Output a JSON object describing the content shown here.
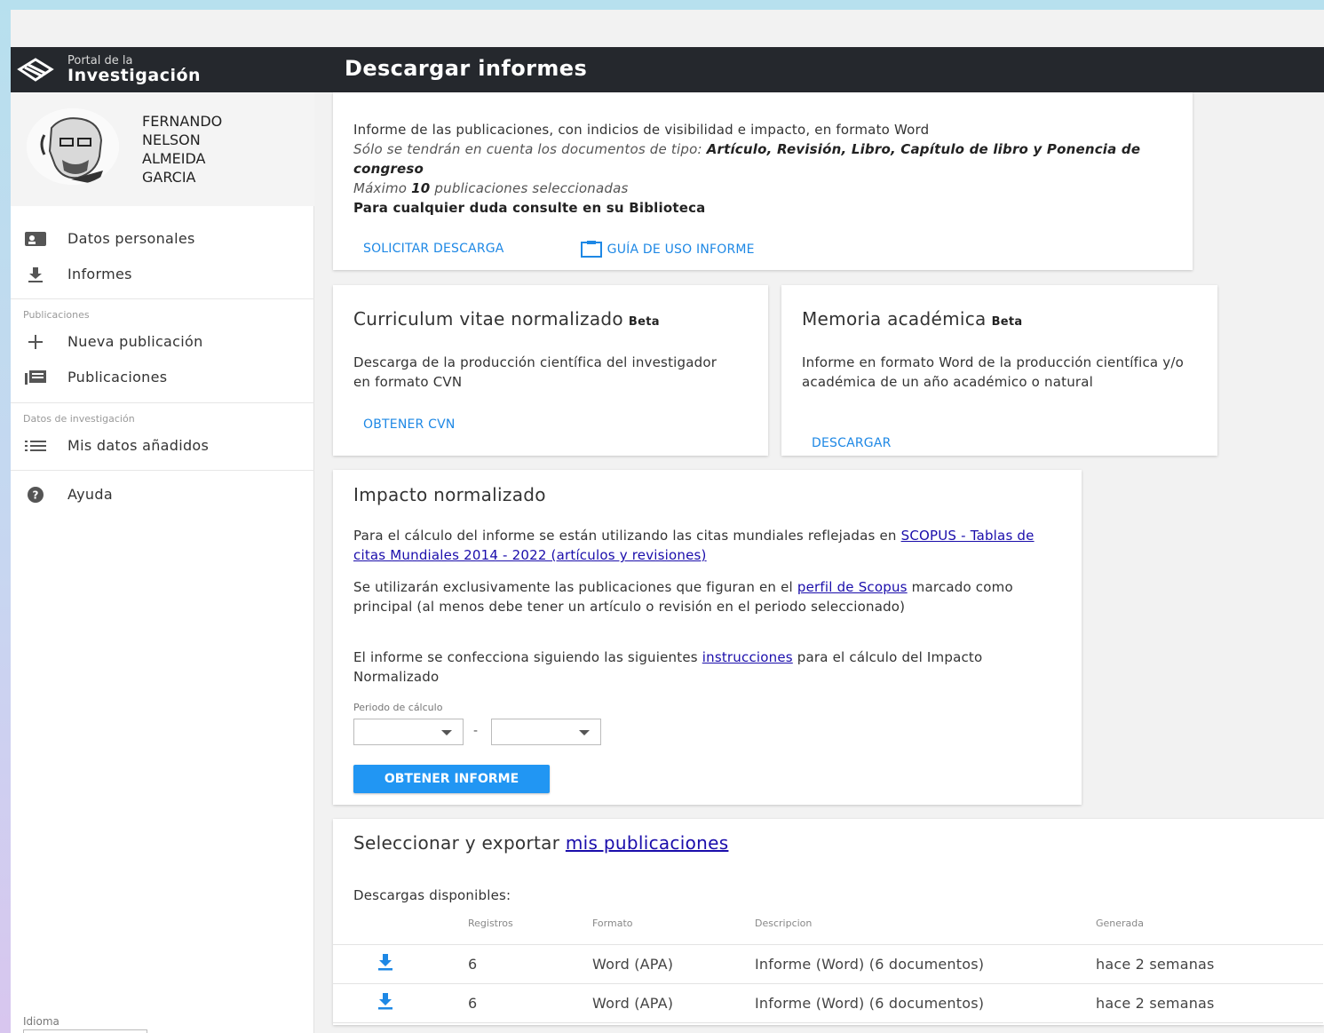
{
  "header": {
    "brand_small": "Portal de la",
    "brand_large": "Investigación",
    "page_title": "Descargar informes"
  },
  "sidebar": {
    "user_name": [
      "FERNANDO",
      "NELSON",
      "ALMEIDA",
      "GARCIA"
    ],
    "items_main": [
      {
        "label": "Datos personales",
        "icon": "id-card-icon"
      },
      {
        "label": "Informes",
        "icon": "download-icon"
      }
    ],
    "section_publicaciones": "Publicaciones",
    "items_publicaciones": [
      {
        "label": "Nueva publicación",
        "icon": "plus-icon"
      },
      {
        "label": "Publicaciones",
        "icon": "library-icon"
      }
    ],
    "section_datos": "Datos de investigación",
    "items_datos": [
      {
        "label": "Mis datos añadidos",
        "icon": "list-icon"
      }
    ],
    "help": {
      "label": "Ayuda",
      "icon": "help-icon"
    },
    "language_label": "Idioma"
  },
  "card_publicaciones": {
    "line1": "Informe de las publicaciones, con indicios de visibilidad e impacto, en formato Word",
    "line2_italic": "Sólo se tendrán en cuenta los documentos de tipo: ",
    "line2_bold": "Artículo, Revisión, Libro, Capítulo de libro y Ponencia de congreso",
    "line3_pre": "Máximo ",
    "line3_num": "10",
    "line3_post": " publicaciones seleccionadas",
    "line4": "Para cualquier duda consulte en su Biblioteca",
    "btn_request": "SOLICITAR DESCARGA",
    "btn_guide": "GUÍA DE USO INFORME"
  },
  "card_cvn": {
    "title": "Curriculum vitae normalizado",
    "beta": "Beta",
    "desc": "Descarga de la producción científica del investigador en formato CVN",
    "btn": "OBTENER CVN"
  },
  "card_memoria": {
    "title": "Memoria académica",
    "beta": "Beta",
    "desc": "Informe en formato Word de la producción científica y/o académica de un año académico o natural",
    "btn": "DESCARGAR"
  },
  "card_impacto": {
    "title": "Impacto normalizado",
    "p1_text": "Para el cálculo del informe se están utilizando las citas mundiales reflejadas en ",
    "p1_link": "SCOPUS - Tablas de citas Mundiales 2014 - 2022 (artículos y revisiones)",
    "p2_pre": "Se utilizarán exclusivamente las publicaciones que figuran en el ",
    "p2_link": "perfil de Scopus",
    "p2_post": " marcado como principal (al menos debe tener un artículo o revisión en el periodo seleccionado)",
    "p3_pre": "El informe se confecciona siguiendo las siguientes ",
    "p3_link": "instrucciones",
    "p3_post": " para el cálculo del Impacto Normalizado",
    "period_label": "Periodo de cálculo",
    "period_sep": "-",
    "btn": "OBTENER INFORME"
  },
  "card_export": {
    "title_pre": "Seleccionar y exportar ",
    "title_link": "mis publicaciones",
    "downloads_label": "Descargas disponibles:",
    "columns": [
      "Registros",
      "Formato",
      "Descripcion",
      "Generada"
    ],
    "rows": [
      {
        "registros": "6",
        "formato": "Word (APA)",
        "descripcion": "Informe (Word) (6 documentos)",
        "generada": "hace 2 semanas"
      },
      {
        "registros": "6",
        "formato": "Word (APA)",
        "descripcion": "Informe (Word) (6 documentos)",
        "generada": "hace 2 semanas"
      }
    ]
  },
  "colors": {
    "topbar": "#25282d",
    "accent": "#2196f3",
    "link": "#1a0dab"
  }
}
